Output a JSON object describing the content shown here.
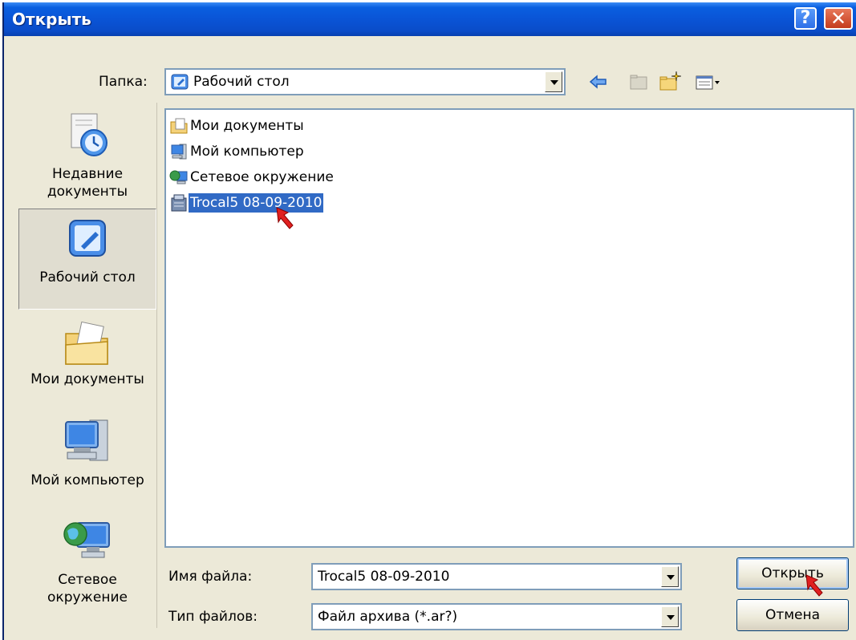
{
  "window": {
    "title": "Открыть",
    "help_button": "?",
    "close_button": "✕"
  },
  "folder": {
    "label": "Папка:",
    "value": "Рабочий стол"
  },
  "toolbar": {
    "back_icon": "back-arrow-icon",
    "up_icon": "folder-up-icon",
    "new_folder_icon": "new-folder-icon",
    "view_icon": "view-menu-icon"
  },
  "places": [
    {
      "label_line1": "Недавние",
      "label_line2": "документы"
    },
    {
      "label_line1": "Рабочий стол",
      "label_line2": ""
    },
    {
      "label_line1": "Мои документы",
      "label_line2": ""
    },
    {
      "label_line1": "Мой компьютер",
      "label_line2": ""
    },
    {
      "label_line1": "Сетевое",
      "label_line2": "окружение"
    }
  ],
  "files": [
    {
      "name": "Мои документы"
    },
    {
      "name": "Мой компьютер"
    },
    {
      "name": "Сетевое окружение"
    },
    {
      "name": "Trocal5 08-09-2010"
    }
  ],
  "filename": {
    "label": "Имя файла:",
    "value": "Trocal5 08-09-2010"
  },
  "filetype": {
    "label": "Тип файлов:",
    "value": "Файл архива (*.ar?)"
  },
  "buttons": {
    "open": "Открыть",
    "cancel": "Отмена"
  },
  "colors": {
    "title_bar": "#0a54d6",
    "selection": "#316ac5",
    "annotation_arrow": "#e02020"
  }
}
